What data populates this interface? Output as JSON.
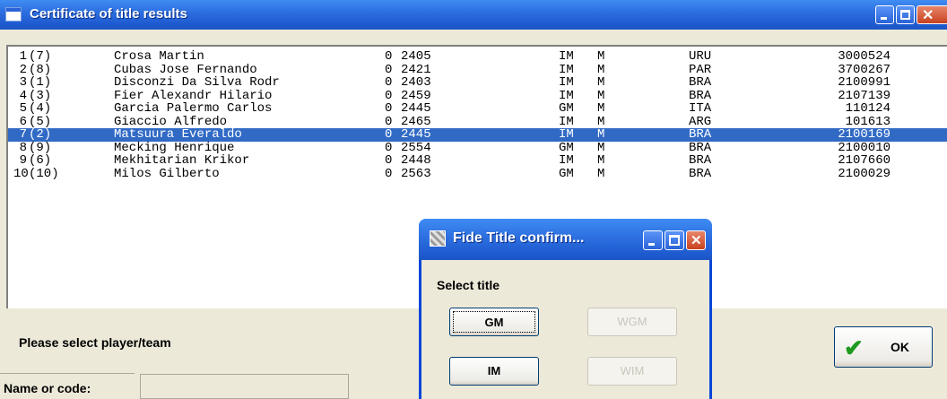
{
  "window": {
    "title": "Certificate of title results"
  },
  "players": [
    {
      "num": "1",
      "pos": "(7)",
      "name": "Crosa Martin",
      "flag": "0",
      "rating": "2405",
      "title": "IM",
      "sex": "M",
      "fed": "URU",
      "id": "3000524",
      "selected": false
    },
    {
      "num": "2",
      "pos": "(8)",
      "name": "Cubas Jose Fernando",
      "flag": "0",
      "rating": "2421",
      "title": "IM",
      "sex": "M",
      "fed": "PAR",
      "id": "3700267",
      "selected": false
    },
    {
      "num": "3",
      "pos": "(1)",
      "name": "Disconzi Da Silva Rodr",
      "flag": "0",
      "rating": "2403",
      "title": "IM",
      "sex": "M",
      "fed": "BRA",
      "id": "2100991",
      "selected": false
    },
    {
      "num": "4",
      "pos": "(3)",
      "name": "Fier Alexandr Hilario",
      "flag": "0",
      "rating": "2459",
      "title": "IM",
      "sex": "M",
      "fed": "BRA",
      "id": "2107139",
      "selected": false
    },
    {
      "num": "5",
      "pos": "(4)",
      "name": "Garcia Palermo Carlos",
      "flag": "0",
      "rating": "2445",
      "title": "GM",
      "sex": "M",
      "fed": "ITA",
      "id": "110124",
      "selected": false
    },
    {
      "num": "6",
      "pos": "(5)",
      "name": "Giaccio Alfredo",
      "flag": "0",
      "rating": "2465",
      "title": "IM",
      "sex": "M",
      "fed": "ARG",
      "id": "101613",
      "selected": false
    },
    {
      "num": "7",
      "pos": "(2)",
      "name": "Matsuura Everaldo",
      "flag": "0",
      "rating": "2445",
      "title": "IM",
      "sex": "M",
      "fed": "BRA",
      "id": "2100169",
      "selected": true
    },
    {
      "num": "8",
      "pos": "(9)",
      "name": "Mecking Henrique",
      "flag": "0",
      "rating": "2554",
      "title": "GM",
      "sex": "M",
      "fed": "BRA",
      "id": "2100010",
      "selected": false
    },
    {
      "num": "9",
      "pos": "(6)",
      "name": "Mekhitarian Krikor",
      "flag": "0",
      "rating": "2448",
      "title": "IM",
      "sex": "M",
      "fed": "BRA",
      "id": "2107660",
      "selected": false
    },
    {
      "num": "10",
      "pos": "(10)",
      "name": "Milos Gilberto",
      "flag": "0",
      "rating": "2563",
      "title": "GM",
      "sex": "M",
      "fed": "BRA",
      "id": "2100029",
      "selected": false
    }
  ],
  "panel": {
    "prompt": "Please select player/team",
    "name_label": "Name or code:",
    "name_value": "",
    "ok_label": "OK"
  },
  "dialog": {
    "title": "Fide Title confirm...",
    "label": "Select title",
    "buttons": {
      "gm": "GM",
      "wgm": "WGM",
      "im": "IM",
      "wim": "WIM"
    }
  },
  "colors": {
    "selection": "#316ac5",
    "titlebar": "#2d6fe0",
    "ok_check": "#1f9a1f"
  }
}
